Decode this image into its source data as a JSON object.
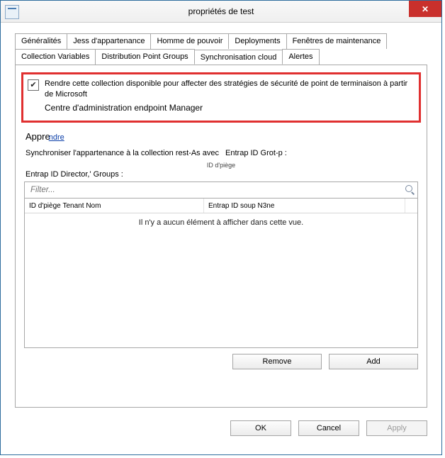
{
  "window": {
    "title": "propriétés de test",
    "close_glyph": "✕"
  },
  "tabs_row1": [
    {
      "label": "Généralités"
    },
    {
      "label": "Jess d'appartenance"
    },
    {
      "label": "Homme de pouvoir",
      "sub": "pouvoir"
    },
    {
      "label": "Deployments"
    },
    {
      "label": "Fenêtres de maintenance"
    }
  ],
  "tabs_row2": [
    {
      "label": "Collection Variables"
    },
    {
      "label": "Distribution Point Groups",
      "sub": "Groups"
    },
    {
      "label": "Synchronisation cloud",
      "sub": "cloud",
      "active": true
    },
    {
      "label": "Alertes"
    }
  ],
  "checkbox": {
    "checked": true,
    "line1": "Rendre cette collection disponible pour affecter des stratégies de sécurité de point de terminaison à partir de Microsoft",
    "line2": "Centre d'administration endpoint Manager"
  },
  "learn": {
    "label": "Appre",
    "link": "ndre"
  },
  "sync_line": {
    "prefix": "Synchroniser l'appartenance à la collection rest-As avec",
    "value": "Entrap ID Grot-p :"
  },
  "small_label": "ID d'piège",
  "groups_label": "Entrap ID Director,' Groups :",
  "filter_placeholder": "Filter...",
  "columns": {
    "c1_a": "ID d'piège",
    "c1_b": "Tenant",
    "c1_c": "Nom",
    "c2": "Entrap ID soup N3ne"
  },
  "empty_message": "Il n'y a aucun élément à afficher dans cette vue.",
  "buttons": {
    "remove": "Remove",
    "add": "Add",
    "ok": "OK",
    "cancel": "Cancel",
    "apply": "Apply"
  },
  "checkmark": "✔"
}
